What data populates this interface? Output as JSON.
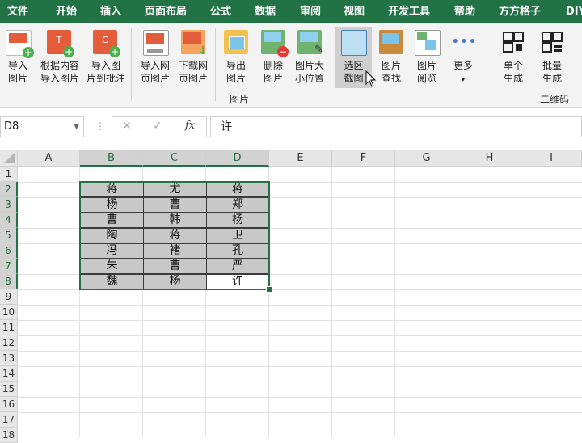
{
  "tabs": [
    "文件",
    "开始",
    "插入",
    "页面布局",
    "公式",
    "数据",
    "审阅",
    "视图",
    "开发工具",
    "帮助",
    "方方格子",
    "DIY"
  ],
  "ribbon": {
    "buttons": [
      {
        "label1": "导入",
        "label2": "图片",
        "icon": "import-picture-icon"
      },
      {
        "label1": "根据内容",
        "label2": "导入图片",
        "icon": "import-by-content-icon"
      },
      {
        "label1": "导入图",
        "label2": "片到批注",
        "icon": "import-to-comment-icon"
      },
      {
        "label1": "导入网",
        "label2": "页图片",
        "icon": "import-web-picture-icon"
      },
      {
        "label1": "下载网",
        "label2": "页图片",
        "icon": "download-web-picture-icon"
      },
      {
        "label1": "导出",
        "label2": "图片",
        "icon": "export-picture-icon"
      },
      {
        "label1": "删除",
        "label2": "图片",
        "icon": "delete-picture-icon"
      },
      {
        "label1": "图片大",
        "label2": "小位置",
        "icon": "picture-size-icon"
      },
      {
        "label1": "选区",
        "label2": "截图",
        "icon": "selection-screenshot-icon"
      },
      {
        "label1": "图片",
        "label2": "查找",
        "icon": "picture-find-icon"
      },
      {
        "label1": "图片",
        "label2": "阅览",
        "icon": "picture-browse-icon"
      },
      {
        "label1": "更多",
        "label2": "",
        "icon": "more-icon"
      },
      {
        "label1": "单个",
        "label2": "生成",
        "icon": "qr-single-icon"
      },
      {
        "label1": "批量",
        "label2": "生成",
        "icon": "qr-batch-icon"
      }
    ],
    "group_picture": "图片",
    "group_qrcode": "二维码"
  },
  "formula_bar": {
    "name_box": "D8",
    "cancel": "✕",
    "confirm": "✓",
    "fx": "fx",
    "value": "许"
  },
  "columns": [
    "A",
    "B",
    "C",
    "D",
    "E",
    "F",
    "G",
    "H",
    "I"
  ],
  "rows": [
    "1",
    "2",
    "3",
    "4",
    "5",
    "6",
    "7",
    "8",
    "9",
    "10",
    "11",
    "12",
    "13",
    "14",
    "15",
    "16",
    "17",
    "18"
  ],
  "table": [
    [
      "蒋",
      "尤",
      "蒋"
    ],
    [
      "杨",
      "曹",
      "郑"
    ],
    [
      "曹",
      "韩",
      "杨"
    ],
    [
      "陶",
      "蒋",
      "卫"
    ],
    [
      "冯",
      "褚",
      "孔"
    ],
    [
      "朱",
      "曹",
      "严"
    ],
    [
      "魏",
      "杨",
      "许"
    ]
  ]
}
